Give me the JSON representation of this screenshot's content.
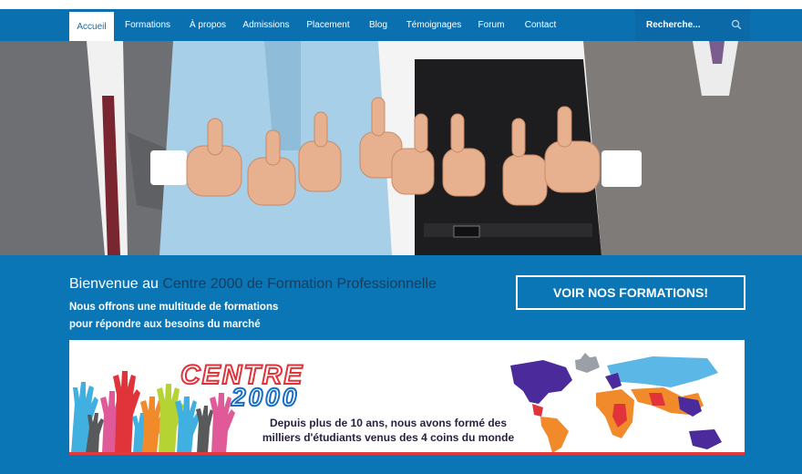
{
  "nav": {
    "items": [
      {
        "label": "Accueil",
        "active": true
      },
      {
        "label": "Formations"
      },
      {
        "label": "À propos"
      },
      {
        "label": "Admissions"
      },
      {
        "label": "Placement"
      },
      {
        "label": "Blog"
      },
      {
        "label": "Témoignages"
      },
      {
        "label": "Forum"
      },
      {
        "label": "Contact"
      }
    ],
    "search": {
      "placeholder": "Recherche...",
      "icon": "search-icon"
    }
  },
  "hero": {
    "alt": "photo-people-thumbs-up"
  },
  "welcome": {
    "title_prefix": "Bienvenue au ",
    "title_accent": "Centre 2000 de Formation Professionnelle",
    "subtitle_line1": "Nous offrons une multitude de formations",
    "subtitle_line2": "pour répondre aux besoins du marché"
  },
  "cta": {
    "label": "VOIR NOS FORMATIONS!"
  },
  "banner": {
    "logo_line1": "CENTRE",
    "logo_line2": "2000",
    "text_line1": "Depuis plus de 10 ans, nous avons formé des",
    "text_line2": "milliers d'étudiants venus des 4 coins du monde"
  },
  "colors": {
    "primary": "#0b76b6",
    "navbar": "#0b70b0",
    "accent_text": "#163d5c",
    "logo_red": "#e0333a",
    "logo_blue": "#1a6fc4"
  }
}
